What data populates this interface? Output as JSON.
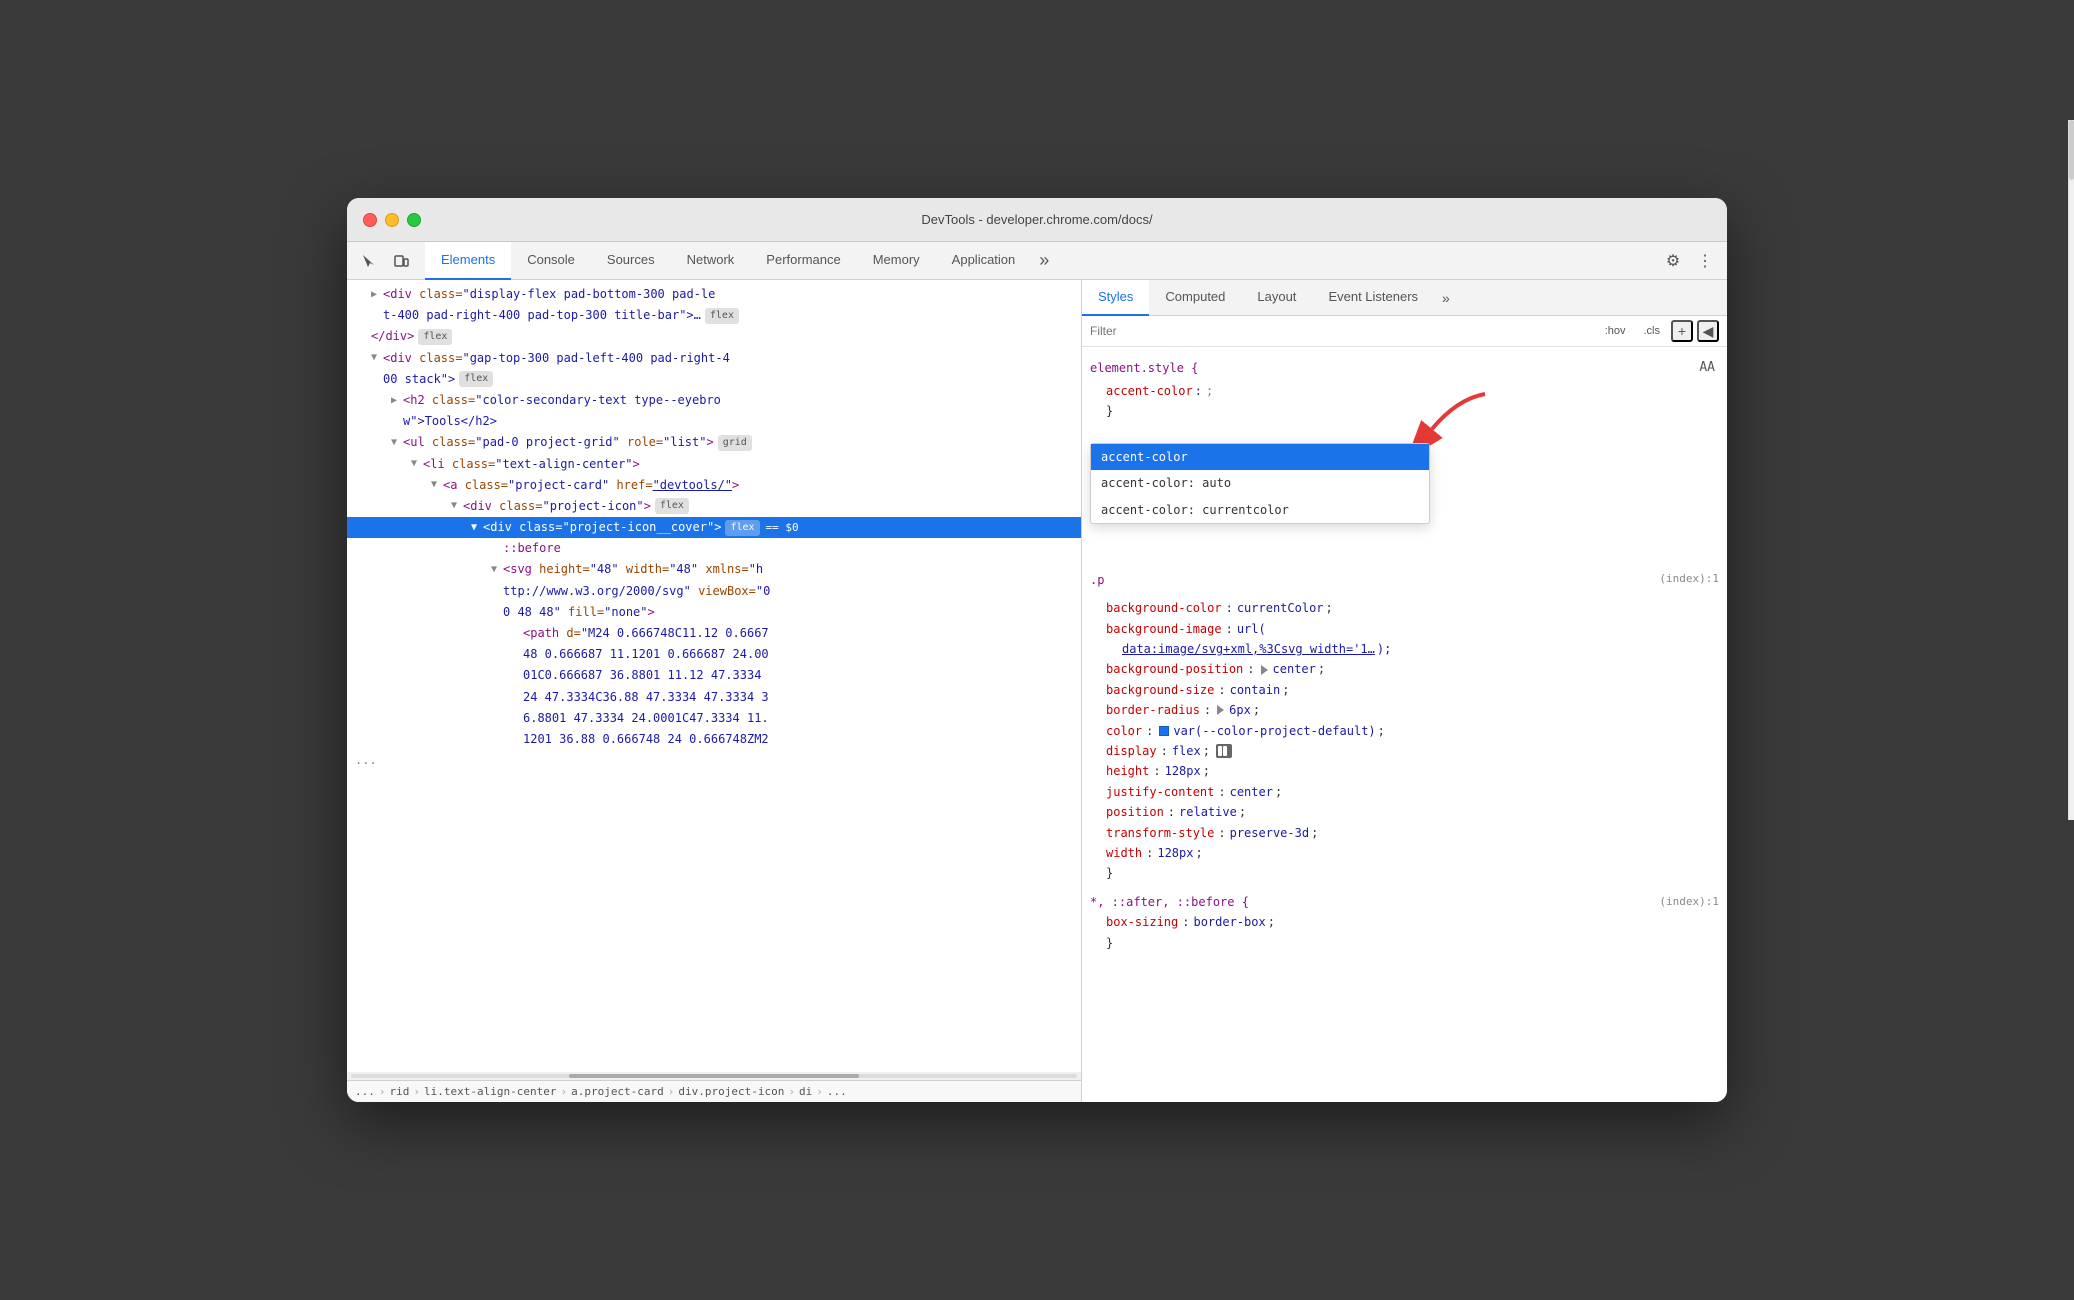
{
  "window": {
    "title": "DevTools - developer.chrome.com/docs/"
  },
  "toolbar": {
    "tabs": [
      {
        "label": "Elements",
        "active": true
      },
      {
        "label": "Console",
        "active": false
      },
      {
        "label": "Sources",
        "active": false
      },
      {
        "label": "Network",
        "active": false
      },
      {
        "label": "Performance",
        "active": false
      },
      {
        "label": "Memory",
        "active": false
      },
      {
        "label": "Application",
        "active": false
      }
    ],
    "overflow_label": "»",
    "settings_label": "⚙",
    "more_label": "⋮"
  },
  "styles_panel": {
    "tabs": [
      {
        "label": "Styles",
        "active": true
      },
      {
        "label": "Computed",
        "active": false
      },
      {
        "label": "Layout",
        "active": false
      },
      {
        "label": "Event Listeners",
        "active": false
      }
    ],
    "overflow_label": "»",
    "filter_placeholder": "Filter",
    "hov_label": ":hov",
    "cls_label": ".cls",
    "add_label": "+",
    "toggle_label": "◀"
  },
  "dom": {
    "lines": [
      {
        "text": "<div class=\"display-flex pad-bottom-300 pad-left-400 pad-right-400 pad-top-300 title-bar\">…",
        "indent": 1,
        "has_expand": false,
        "badge": "flex",
        "selected": false,
        "color": "tag"
      },
      {
        "text": "</div>",
        "indent": 1,
        "badge": "flex",
        "selected": false
      },
      {
        "text": "<div class=\"gap-top-300 pad-left-400 pad-right-400 stack\">",
        "indent": 1,
        "has_expand": true,
        "badge": "flex",
        "selected": false
      },
      {
        "text": "<h2 class=\"color-secondary-text type--eyebrow\">Tools</h2>",
        "indent": 2,
        "selected": false
      },
      {
        "text": "<ul class=\"pad-0 project-grid\" role=\"list\">",
        "indent": 2,
        "has_expand": true,
        "selected": false
      },
      {
        "text": "<li class=\"text-align-center\">",
        "indent": 3,
        "has_expand": true,
        "selected": false
      },
      {
        "text": "<a class=\"project-card\" href=\"devtools/\">",
        "indent": 4,
        "has_expand": true,
        "selected": false
      },
      {
        "text": "<div class=\"project-icon\">",
        "indent": 5,
        "has_expand": true,
        "badge": "flex",
        "selected": false
      },
      {
        "text": "<div class=\"project-icon__cover\">",
        "indent": 6,
        "selected": true,
        "badge_selected": "flex",
        "equal_selected": "== $0"
      },
      {
        "text": "::before",
        "indent": 7,
        "selected": false,
        "pseudo": true
      },
      {
        "text": "<svg height=\"48\" width=\"48\" xmlns=\"http://www.w3.org/2000/svg\" viewBox=\"0 0 48 48\" fill=\"none\">",
        "indent": 7,
        "has_expand": true,
        "selected": false
      },
      {
        "text": "<path d=\"M24 0.666748C11.12 0.666748 0.666687 11.1201 0.666687 24.0001C0.666687 36.8801 11.12 47.3334 24 47.3334C36.88 47.3334 47.3334 36.8801 47.3334 24.0001C47.3334 11.1201 36.88 0.666748 24 0.666748ZM2",
        "indent": 8,
        "selected": false,
        "path": true
      }
    ]
  },
  "css": {
    "element_style": {
      "selector": "element.style {",
      "properties": [
        {
          "prop": "accent-color",
          "value": "",
          "editing": true
        }
      ]
    },
    "p_rule": {
      "selector": ".p",
      "source": "(index):1"
    },
    "properties_block": [
      {
        "prop": "background-color",
        "value": "currentColor"
      },
      {
        "prop": "background-image",
        "value": "url("
      },
      {
        "prop": "data_url",
        "value": "data:image/svg+xml,%3Csvg width='1…",
        "is_link": true
      },
      {
        "prop": "background-position",
        "value": "▶ center"
      },
      {
        "prop": "background-size",
        "value": "contain"
      },
      {
        "prop": "border-radius",
        "value": "▶ 6px"
      },
      {
        "prop": "color",
        "value": "var(--color-project-default)",
        "has_swatch": true
      },
      {
        "prop": "display",
        "value": "flex",
        "has_icon": true
      },
      {
        "prop": "height",
        "value": "128px"
      },
      {
        "prop": "justify-content",
        "value": "center"
      },
      {
        "prop": "position",
        "value": "relative"
      },
      {
        "prop": "transform-style",
        "value": "preserve-3d"
      },
      {
        "prop": "width",
        "value": "128px"
      }
    ],
    "universal_rule": {
      "selector": "*, ::after, ::before {",
      "source": "(index):1",
      "properties": [
        {
          "prop": "box-sizing",
          "value": "border-box"
        }
      ]
    }
  },
  "autocomplete": {
    "items": [
      {
        "label": "accent-color",
        "selected": true
      },
      {
        "label": "accent-color: auto",
        "selected": false
      },
      {
        "label": "accent-color: currentcolor",
        "selected": false
      }
    ]
  },
  "breadcrumb": {
    "items": [
      "...",
      "rid",
      "li.text-align-center",
      "a.project-card",
      "div.project-icon",
      "di",
      "..."
    ]
  }
}
